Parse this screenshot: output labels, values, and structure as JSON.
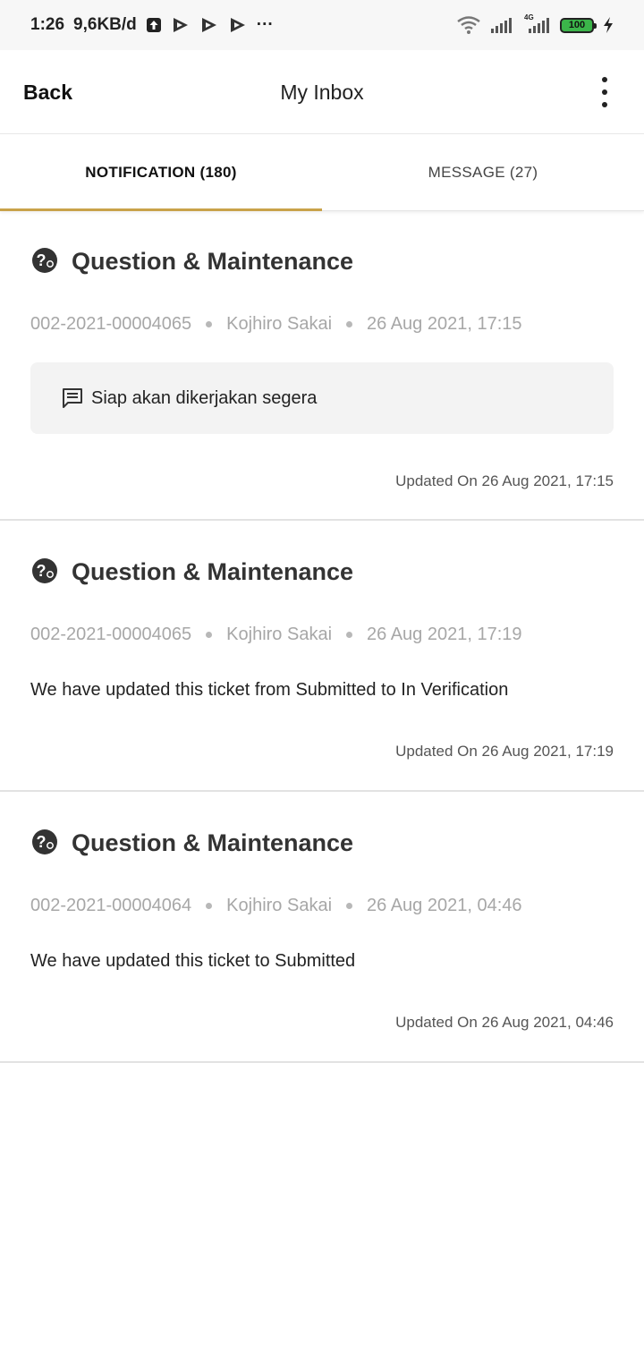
{
  "status_bar": {
    "time": "1:26",
    "net_speed": "9,6KB/d",
    "more": "···",
    "network": "4G",
    "battery": "100"
  },
  "header": {
    "back_label": "Back",
    "title": "My Inbox"
  },
  "tabs": [
    {
      "label": "NOTIFICATION (180)",
      "active": true
    },
    {
      "label": "MESSAGE (27)",
      "active": false
    }
  ],
  "notifications": [
    {
      "title": "Question & Maintenance",
      "ticket": "002-2021-00004065",
      "user": "Kojhiro Sakai",
      "date": "26 Aug 2021, 17:15",
      "comment": "Siap akan dikerjakan segera",
      "updated": "Updated On 26 Aug 2021, 17:15"
    },
    {
      "title": "Question & Maintenance",
      "ticket": "002-2021-00004065",
      "user": "Kojhiro Sakai",
      "date": "26 Aug 2021, 17:19",
      "message": "We have updated this ticket from Submitted to In Verification",
      "updated": "Updated On 26 Aug 2021, 17:19"
    },
    {
      "title": "Question & Maintenance",
      "ticket": "002-2021-00004064",
      "user": "Kojhiro Sakai",
      "date": "26 Aug 2021, 04:46",
      "message": "We have updated this ticket to Submitted",
      "updated": "Updated On 26 Aug 2021, 04:46"
    }
  ],
  "colors": {
    "accent": "#c9a24a",
    "battery": "#3bb54a"
  }
}
